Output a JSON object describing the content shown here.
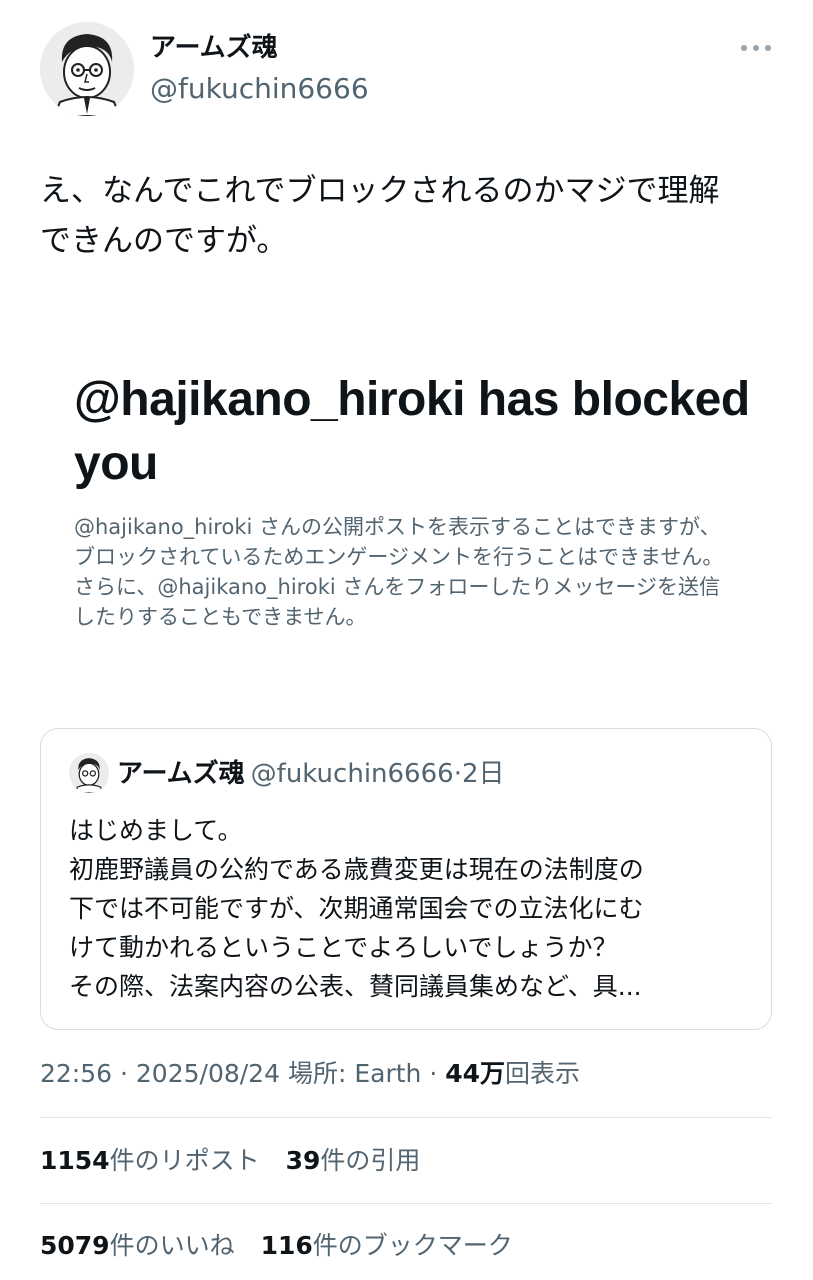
{
  "author": {
    "display_name": "アームズ魂",
    "handle": "@fukuchin6666",
    "avatar_icon": "cartoon-man-avatar"
  },
  "tweet": {
    "text": "え、なんでこれでブロックされるのかマジで理解\nできんのですが。"
  },
  "embedded_screenshot": {
    "title": "@hajikano_hiroki has blocked you",
    "body": "@hajikano_hiroki さんの公開ポストを表示することはできますが、ブロックされているためエンゲージメントを行うことはできません。さらに、@hajikano_hiroki さんをフォローしたりメッセージを送信したりすることもできません。"
  },
  "quote": {
    "display_name": "アームズ魂",
    "handle": "@fukuchin6666",
    "separator": "·",
    "time": "2日",
    "lines": [
      "はじめまして。",
      "初鹿野議員の公約である歳費変更は現在の法制度の",
      "下では不可能ですが、次期通常国会での立法化にむ",
      "けて動かれるということでよろしいでしょうか？",
      "その際、法案内容の公表、賛同議員集めなど、具..."
    ]
  },
  "meta": {
    "time": "22:56",
    "date": "2025/08/24",
    "location_label": "場所: Earth",
    "separator": "·",
    "views_count": "44万",
    "views_label": "回表示"
  },
  "stats": {
    "reposts_count": "1154",
    "reposts_label": "件のリポスト",
    "quotes_count": "39",
    "quotes_label": "件の引用",
    "likes_count": "5079",
    "likes_label": "件のいいね",
    "bookmarks_count": "116",
    "bookmarks_label": "件のブックマーク"
  },
  "colors": {
    "text_primary": "#0f1419",
    "text_secondary": "#536471",
    "border": "#d7dde2"
  }
}
